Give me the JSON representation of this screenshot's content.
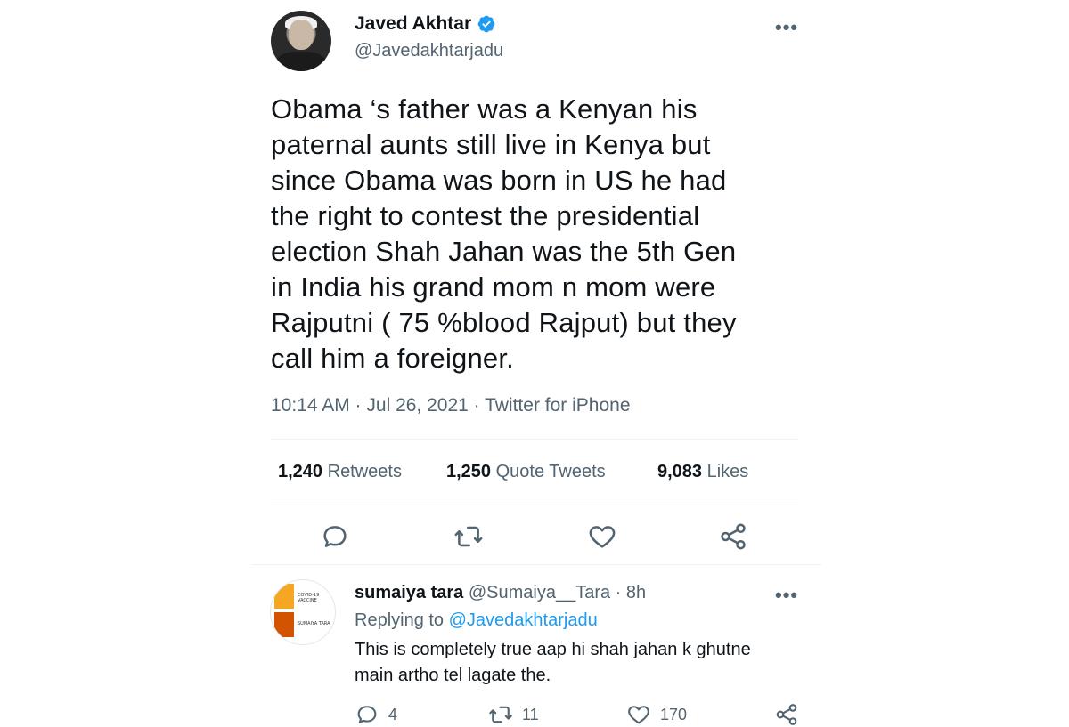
{
  "tweet": {
    "author_name": "Javed Akhtar",
    "author_handle": "@Javedakhtarjadu",
    "more_label": "•••",
    "text": "Obama ‘s father was a Kenyan his\npaternal  aunts still live in Kenya but\nsince  Obama was born in US he had\nthe right to contest the presidential\nelection Shah Jahan was the 5th Gen\nin India his grand mom n mom were\nRajputni ( 75 %blood Rajput) but they\ncall him a foreigner.",
    "meta": "10:14 AM · Jul 26, 2021 · Twitter for iPhone",
    "stats": {
      "retweets_num": "1,240",
      "retweets_label": " Retweets",
      "quotes_num": "1,250",
      "quotes_label": " Quote Tweets",
      "likes_num": "9,083",
      "likes_label": " Likes"
    }
  },
  "reply": {
    "author_name": "sumaiya tara",
    "author_handle_time": " @Sumaiya__Tara · 8h",
    "more_label": "•••",
    "replying_prefix": "Replying to ",
    "replying_mention": "@Javedakhtarjadu",
    "text": "This is completely true aap hi shah jahan k ghutne main artho tel lagate the.",
    "avatar_text_top": "COVID-19 VACCINE",
    "avatar_text_bottom": "SUMAIYA TARA",
    "reply_count": "4",
    "retweet_count": "11",
    "like_count": "170"
  },
  "colors": {
    "verified": "#1d9bf0",
    "text": "#0f1419",
    "secondary": "#536471",
    "link": "#1d9bf0"
  },
  "icons": [
    "verified-badge-icon",
    "more-icon",
    "reply-icon",
    "retweet-icon",
    "like-icon",
    "share-icon"
  ]
}
